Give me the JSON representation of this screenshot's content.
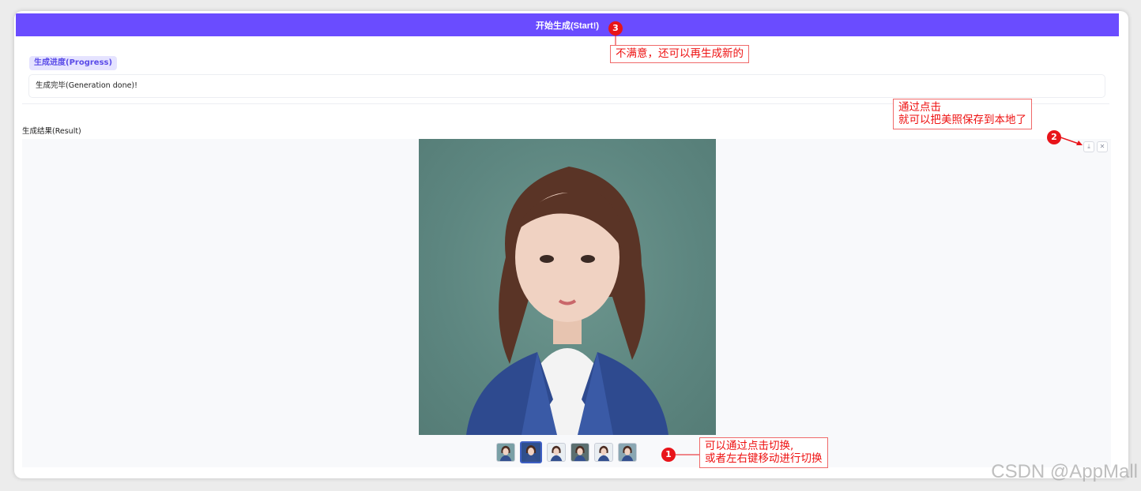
{
  "start_button": {
    "label": "开始生成(Start!)"
  },
  "progress": {
    "label": "生成进度(Progress)",
    "status": "生成完毕(Generation done)!"
  },
  "result": {
    "label": "生成结果(Result)",
    "download_icon": "download-icon",
    "close_icon": "close-icon",
    "thumbnail_count": 6,
    "selected_index": 1
  },
  "annotations": {
    "note3": {
      "badge": "3",
      "text": "不满意，还可以再生成新的"
    },
    "note2": {
      "badge": "2",
      "line1": "通过点击",
      "line2": "就可以把美照保存到本地了"
    },
    "note1": {
      "badge": "1",
      "line1": "可以通过点击切换,",
      "line2": "或者左右键移动进行切换"
    }
  },
  "watermark": "CSDN @AppMall",
  "colors": {
    "accent": "#6a4cff",
    "annotation_red": "#e8141a"
  }
}
